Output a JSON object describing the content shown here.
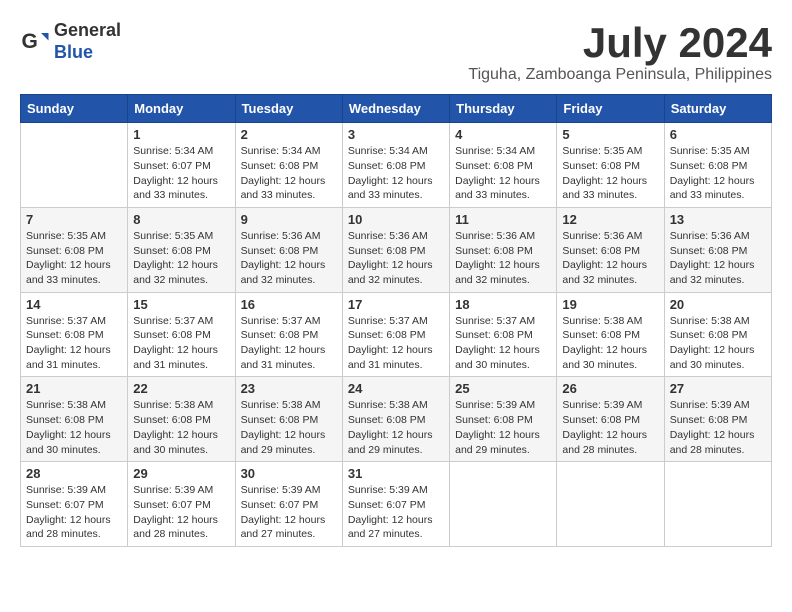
{
  "header": {
    "logo_general": "General",
    "logo_blue": "Blue",
    "month_year": "July 2024",
    "location": "Tiguha, Zamboanga Peninsula, Philippines"
  },
  "days_of_week": [
    "Sunday",
    "Monday",
    "Tuesday",
    "Wednesday",
    "Thursday",
    "Friday",
    "Saturday"
  ],
  "weeks": [
    [
      {
        "date": "",
        "detail": ""
      },
      {
        "date": "1",
        "detail": "Sunrise: 5:34 AM\nSunset: 6:07 PM\nDaylight: 12 hours\nand 33 minutes."
      },
      {
        "date": "2",
        "detail": "Sunrise: 5:34 AM\nSunset: 6:08 PM\nDaylight: 12 hours\nand 33 minutes."
      },
      {
        "date": "3",
        "detail": "Sunrise: 5:34 AM\nSunset: 6:08 PM\nDaylight: 12 hours\nand 33 minutes."
      },
      {
        "date": "4",
        "detail": "Sunrise: 5:34 AM\nSunset: 6:08 PM\nDaylight: 12 hours\nand 33 minutes."
      },
      {
        "date": "5",
        "detail": "Sunrise: 5:35 AM\nSunset: 6:08 PM\nDaylight: 12 hours\nand 33 minutes."
      },
      {
        "date": "6",
        "detail": "Sunrise: 5:35 AM\nSunset: 6:08 PM\nDaylight: 12 hours\nand 33 minutes."
      }
    ],
    [
      {
        "date": "7",
        "detail": "Sunrise: 5:35 AM\nSunset: 6:08 PM\nDaylight: 12 hours\nand 33 minutes."
      },
      {
        "date": "8",
        "detail": "Sunrise: 5:35 AM\nSunset: 6:08 PM\nDaylight: 12 hours\nand 32 minutes."
      },
      {
        "date": "9",
        "detail": "Sunrise: 5:36 AM\nSunset: 6:08 PM\nDaylight: 12 hours\nand 32 minutes."
      },
      {
        "date": "10",
        "detail": "Sunrise: 5:36 AM\nSunset: 6:08 PM\nDaylight: 12 hours\nand 32 minutes."
      },
      {
        "date": "11",
        "detail": "Sunrise: 5:36 AM\nSunset: 6:08 PM\nDaylight: 12 hours\nand 32 minutes."
      },
      {
        "date": "12",
        "detail": "Sunrise: 5:36 AM\nSunset: 6:08 PM\nDaylight: 12 hours\nand 32 minutes."
      },
      {
        "date": "13",
        "detail": "Sunrise: 5:36 AM\nSunset: 6:08 PM\nDaylight: 12 hours\nand 32 minutes."
      }
    ],
    [
      {
        "date": "14",
        "detail": "Sunrise: 5:37 AM\nSunset: 6:08 PM\nDaylight: 12 hours\nand 31 minutes."
      },
      {
        "date": "15",
        "detail": "Sunrise: 5:37 AM\nSunset: 6:08 PM\nDaylight: 12 hours\nand 31 minutes."
      },
      {
        "date": "16",
        "detail": "Sunrise: 5:37 AM\nSunset: 6:08 PM\nDaylight: 12 hours\nand 31 minutes."
      },
      {
        "date": "17",
        "detail": "Sunrise: 5:37 AM\nSunset: 6:08 PM\nDaylight: 12 hours\nand 31 minutes."
      },
      {
        "date": "18",
        "detail": "Sunrise: 5:37 AM\nSunset: 6:08 PM\nDaylight: 12 hours\nand 30 minutes."
      },
      {
        "date": "19",
        "detail": "Sunrise: 5:38 AM\nSunset: 6:08 PM\nDaylight: 12 hours\nand 30 minutes."
      },
      {
        "date": "20",
        "detail": "Sunrise: 5:38 AM\nSunset: 6:08 PM\nDaylight: 12 hours\nand 30 minutes."
      }
    ],
    [
      {
        "date": "21",
        "detail": "Sunrise: 5:38 AM\nSunset: 6:08 PM\nDaylight: 12 hours\nand 30 minutes."
      },
      {
        "date": "22",
        "detail": "Sunrise: 5:38 AM\nSunset: 6:08 PM\nDaylight: 12 hours\nand 30 minutes."
      },
      {
        "date": "23",
        "detail": "Sunrise: 5:38 AM\nSunset: 6:08 PM\nDaylight: 12 hours\nand 29 minutes."
      },
      {
        "date": "24",
        "detail": "Sunrise: 5:38 AM\nSunset: 6:08 PM\nDaylight: 12 hours\nand 29 minutes."
      },
      {
        "date": "25",
        "detail": "Sunrise: 5:39 AM\nSunset: 6:08 PM\nDaylight: 12 hours\nand 29 minutes."
      },
      {
        "date": "26",
        "detail": "Sunrise: 5:39 AM\nSunset: 6:08 PM\nDaylight: 12 hours\nand 28 minutes."
      },
      {
        "date": "27",
        "detail": "Sunrise: 5:39 AM\nSunset: 6:08 PM\nDaylight: 12 hours\nand 28 minutes."
      }
    ],
    [
      {
        "date": "28",
        "detail": "Sunrise: 5:39 AM\nSunset: 6:07 PM\nDaylight: 12 hours\nand 28 minutes."
      },
      {
        "date": "29",
        "detail": "Sunrise: 5:39 AM\nSunset: 6:07 PM\nDaylight: 12 hours\nand 28 minutes."
      },
      {
        "date": "30",
        "detail": "Sunrise: 5:39 AM\nSunset: 6:07 PM\nDaylight: 12 hours\nand 27 minutes."
      },
      {
        "date": "31",
        "detail": "Sunrise: 5:39 AM\nSunset: 6:07 PM\nDaylight: 12 hours\nand 27 minutes."
      },
      {
        "date": "",
        "detail": ""
      },
      {
        "date": "",
        "detail": ""
      },
      {
        "date": "",
        "detail": ""
      }
    ]
  ]
}
